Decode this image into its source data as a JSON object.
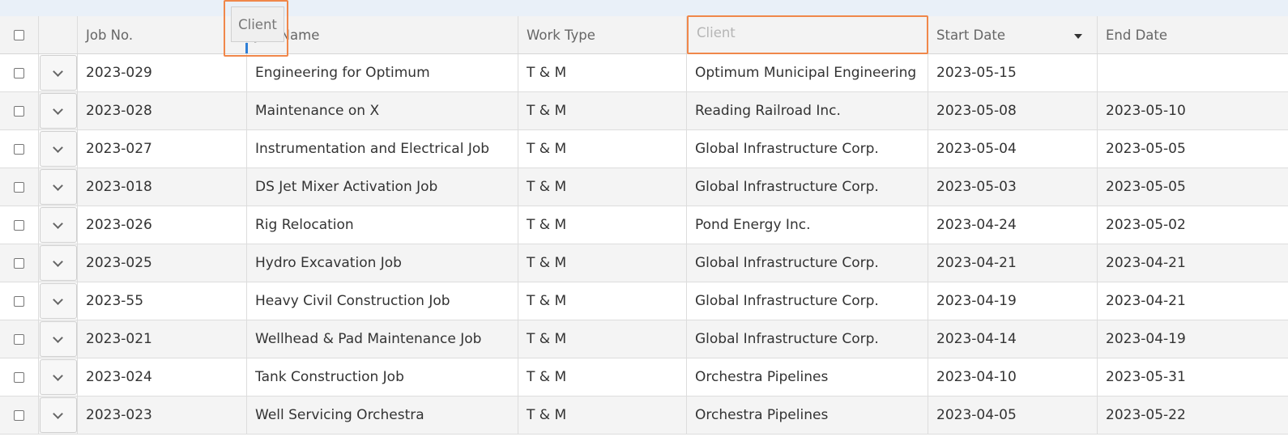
{
  "grid": {
    "columns": {
      "job_no": "Job No.",
      "job_name": "Job Name",
      "work_type": "Work Type",
      "client": "Client",
      "start_date": "Start Date",
      "end_date": "End Date"
    },
    "sort": {
      "column": "Start Date",
      "direction": "descending"
    },
    "drag": {
      "ghost_label": "Client"
    },
    "rows": [
      {
        "job_no": "2023-029",
        "job_name": "Engineering for Optimum",
        "work_type": "T & M",
        "client": "Optimum Municipal Engineering",
        "start_date": "2023-05-15",
        "end_date": ""
      },
      {
        "job_no": "2023-028",
        "job_name": "Maintenance on X",
        "work_type": "T & M",
        "client": "Reading Railroad Inc.",
        "start_date": "2023-05-08",
        "end_date": "2023-05-10"
      },
      {
        "job_no": "2023-027",
        "job_name": "Instrumentation and Electrical Job",
        "work_type": "T & M",
        "client": "Global Infrastructure Corp.",
        "start_date": "2023-05-04",
        "end_date": "2023-05-05"
      },
      {
        "job_no": "2023-018",
        "job_name": "DS Jet Mixer Activation Job",
        "work_type": "T & M",
        "client": "Global Infrastructure Corp.",
        "start_date": "2023-05-03",
        "end_date": "2023-05-05"
      },
      {
        "job_no": "2023-026",
        "job_name": "Rig Relocation",
        "work_type": "T & M",
        "client": "Pond Energy Inc.",
        "start_date": "2023-04-24",
        "end_date": "2023-05-02"
      },
      {
        "job_no": "2023-025",
        "job_name": "Hydro Excavation Job",
        "work_type": "T & M",
        "client": "Global Infrastructure Corp.",
        "start_date": "2023-04-21",
        "end_date": "2023-04-21"
      },
      {
        "job_no": "2023-55",
        "job_name": "Heavy Civil Construction Job",
        "work_type": "T & M",
        "client": "Global Infrastructure Corp.",
        "start_date": "2023-04-19",
        "end_date": "2023-04-21"
      },
      {
        "job_no": "2023-021",
        "job_name": "Wellhead & Pad Maintenance Job",
        "work_type": "T & M",
        "client": "Global Infrastructure Corp.",
        "start_date": "2023-04-14",
        "end_date": "2023-04-19"
      },
      {
        "job_no": "2023-024",
        "job_name": "Tank Construction Job",
        "work_type": "T & M",
        "client": "Orchestra Pipelines",
        "start_date": "2023-04-10",
        "end_date": "2023-05-31"
      },
      {
        "job_no": "2023-023",
        "job_name": "Well Servicing Orchestra",
        "work_type": "T & M",
        "client": "Orchestra Pipelines",
        "start_date": "2023-04-05",
        "end_date": "2023-05-22"
      }
    ]
  },
  "colors": {
    "accent_highlight": "#f0874a",
    "drop_indicator": "#2f7fd6",
    "header_bg": "#f3f3f3",
    "alt_row_bg": "#f4f4f4"
  }
}
